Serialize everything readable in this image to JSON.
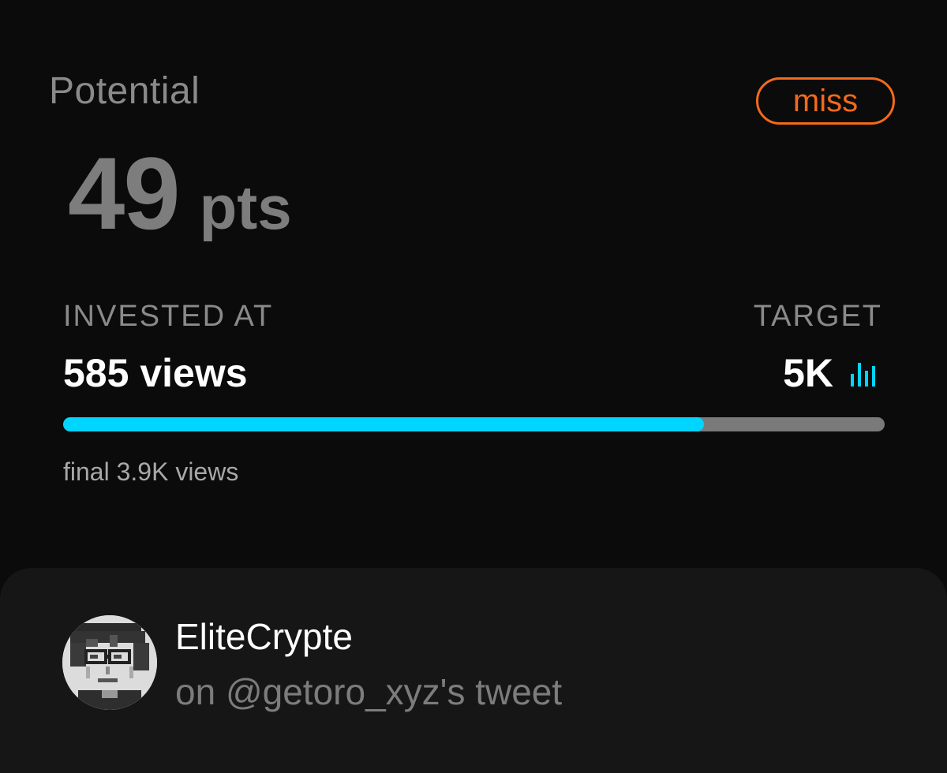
{
  "header": {
    "label": "Potential",
    "status": "miss",
    "points_value": "49",
    "points_unit": "pts"
  },
  "stats": {
    "invested_label": "INVESTED AT",
    "invested_value": "585 views",
    "target_label": "TARGET",
    "target_value": "5K",
    "target_icon": "bar-chart-icon",
    "progress_fraction": 0.78,
    "final_text": "final 3.9K views"
  },
  "post": {
    "username": "EliteCrypte",
    "context": "on @getoro_xyz's tweet",
    "avatar_icon": "pixel-avatar-icon"
  },
  "colors": {
    "accent": "#00d5ff",
    "miss": "#f26a1b",
    "track": "#7a7a7a",
    "background": "#0b0b0b",
    "panel": "#161616"
  }
}
